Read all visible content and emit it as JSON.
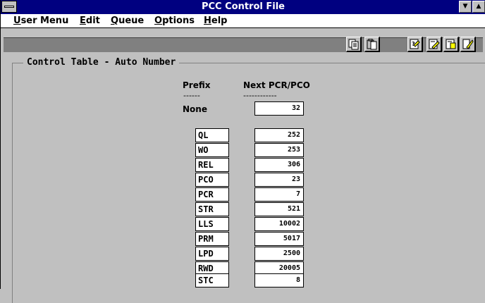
{
  "window": {
    "title": "PCC Control File"
  },
  "menubar": {
    "items": [
      {
        "label": "User Menu",
        "accel": "U"
      },
      {
        "label": "Edit",
        "accel": "E"
      },
      {
        "label": "Queue",
        "accel": "Q"
      },
      {
        "label": "Options",
        "accel": "O"
      },
      {
        "label": "Help",
        "accel": "H"
      }
    ]
  },
  "toolbar": {
    "buttons": [
      "copy-icon",
      "paste-icon",
      "query-icon",
      "query-edit-icon",
      "query-save-icon",
      "query-run-icon"
    ]
  },
  "group": {
    "title": "Control Table - Auto Number",
    "prefix_header": "Prefix",
    "next_header": "Next PCR/PCO",
    "prefix_dashes": "------",
    "next_dashes": "------------",
    "default_label": "None",
    "default_value": "32"
  },
  "rows": [
    {
      "prefix": "QL",
      "next": "252"
    },
    {
      "prefix": "WO",
      "next": "253"
    },
    {
      "prefix": "REL",
      "next": "306"
    },
    {
      "prefix": "PCO",
      "next": "23"
    },
    {
      "prefix": "PCR",
      "next": "7"
    },
    {
      "prefix": "STR",
      "next": "521"
    },
    {
      "prefix": "LLS",
      "next": "10002"
    },
    {
      "prefix": "PRM",
      "next": "5017"
    },
    {
      "prefix": "LPD",
      "next": "2500"
    },
    {
      "prefix": "RWD",
      "next": "20005"
    },
    {
      "prefix": "STC",
      "next": "8"
    }
  ]
}
